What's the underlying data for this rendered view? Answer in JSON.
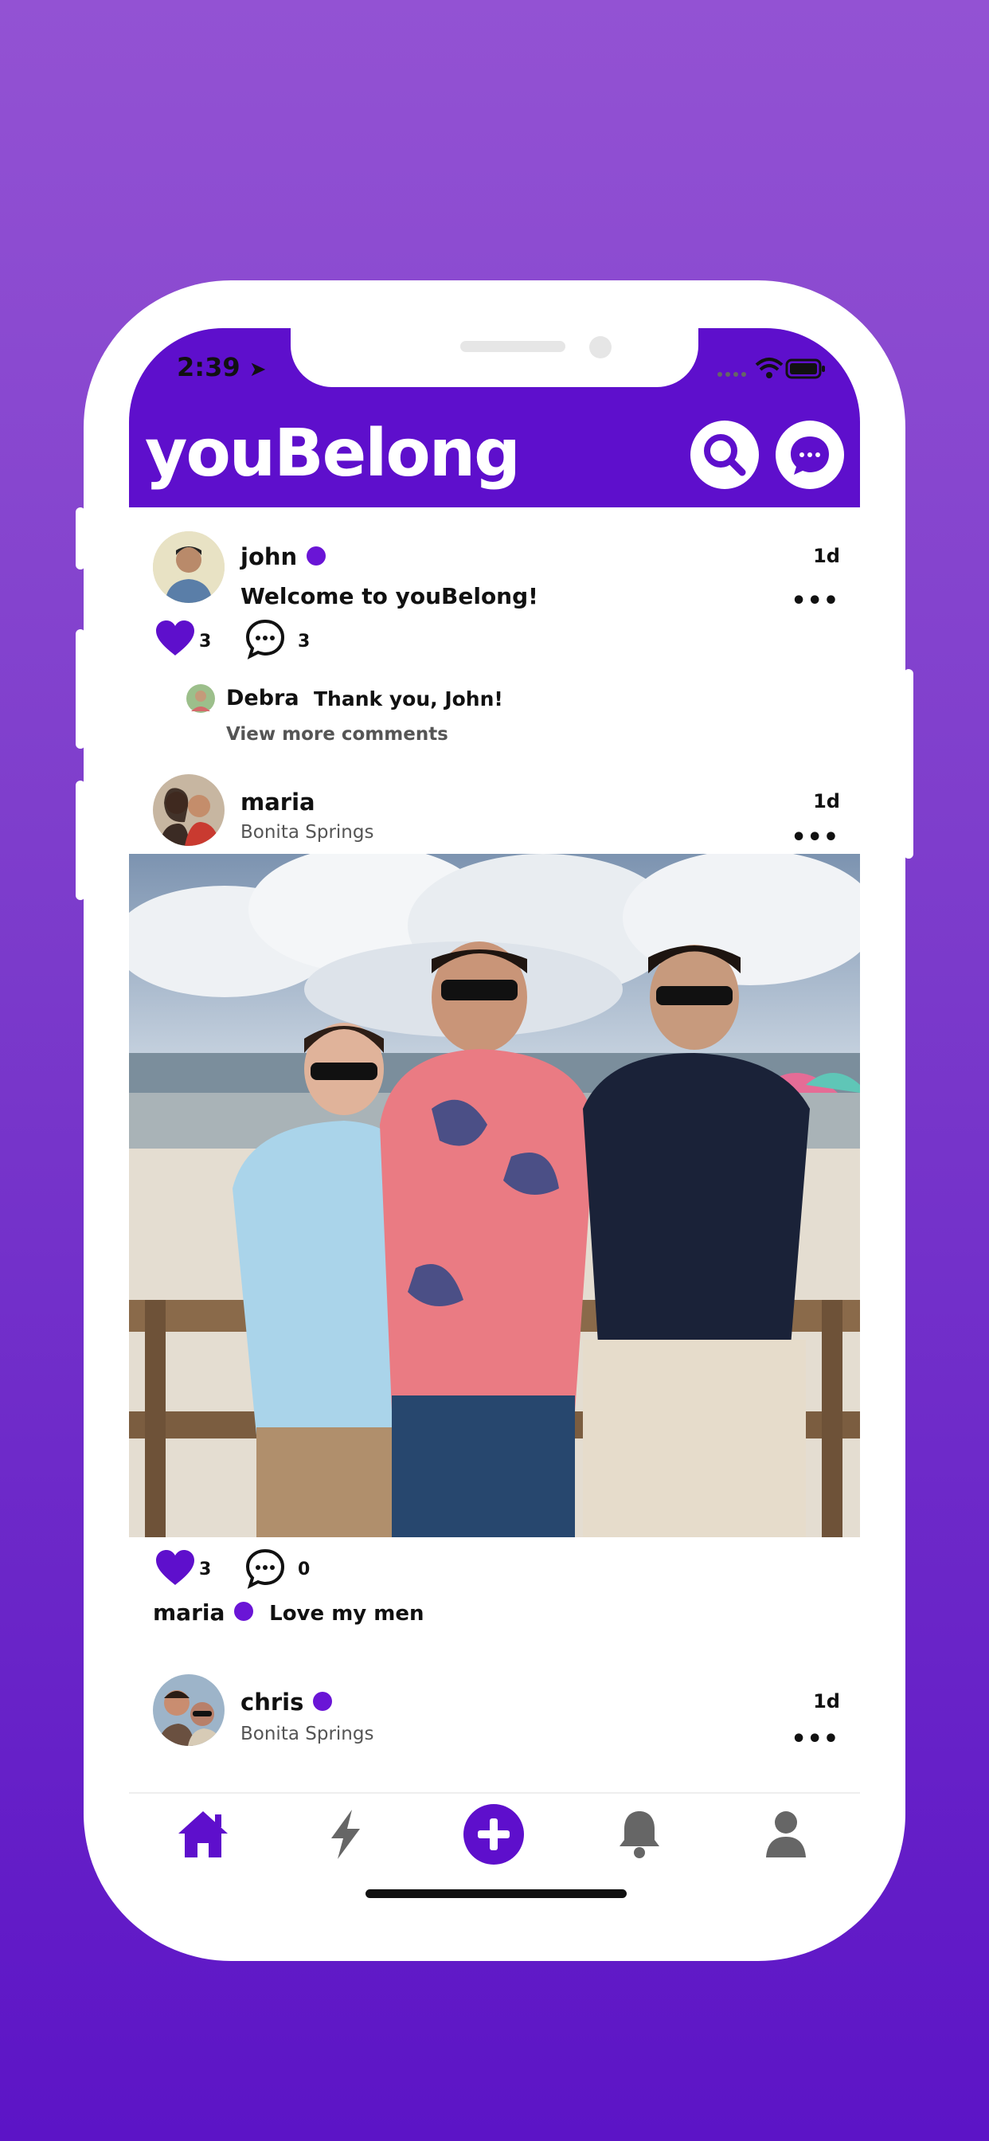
{
  "status_bar": {
    "time": "2:39"
  },
  "app": {
    "title": "youBelong"
  },
  "header_buttons": {
    "search": "search-icon",
    "messages": "chat-bubble-icon"
  },
  "posts": [
    {
      "user": "john",
      "verified": true,
      "age": "1d",
      "text": "Welcome to youBelong!",
      "likes": "3",
      "comments": "3",
      "comment_preview": {
        "author": "Debra",
        "text": "Thank you, John!"
      },
      "view_more": "View more comments"
    },
    {
      "user": "maria",
      "verified": false,
      "location": "Bonita Springs",
      "age": "1d",
      "likes": "3",
      "comments": "0",
      "caption_user": "maria",
      "caption": "Love my men"
    },
    {
      "user": "chris",
      "verified": true,
      "location": "Bonita Springs",
      "age": "1d"
    }
  ],
  "more_label": "•••",
  "tabbar": [
    "home-icon",
    "bolt-icon",
    "add-icon",
    "bell-icon",
    "profile-icon"
  ],
  "colors": {
    "brand": "#5e0fcc",
    "background_top": "#9352d3",
    "background_bottom": "#5c14c6",
    "inactive_icon": "#666666"
  }
}
